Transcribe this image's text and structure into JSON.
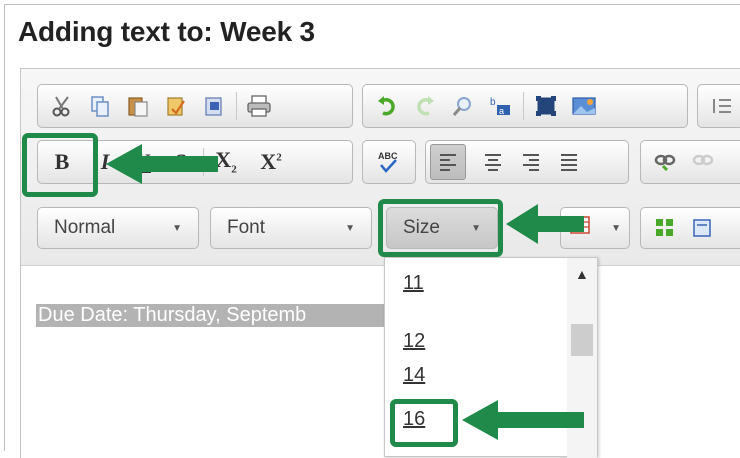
{
  "title": "Adding text to: Week 3",
  "toolbar": {
    "row2": {
      "bold": "B",
      "italic": "I",
      "underline": "U",
      "strike": "S",
      "subscript": "X",
      "subscript_mark": "2",
      "superscript": "X",
      "superscript_mark": "2",
      "spellcheck": "ABC"
    },
    "row3": {
      "format_label": "Normal",
      "font_label": "Font",
      "size_label": "Size"
    }
  },
  "content": {
    "selected_text": "Due Date: Thursday, Septemb"
  },
  "size_dropdown": {
    "options": [
      "11",
      "12",
      "14",
      "16"
    ],
    "highlighted": "16"
  },
  "colors": {
    "highlight": "#1f8a49",
    "selection": "#b3b3b3"
  },
  "icons": [
    "cut-icon",
    "copy-icon",
    "paste-icon",
    "paste-text-icon",
    "paste-word-icon",
    "print-icon",
    "undo-icon",
    "redo-icon",
    "find-icon",
    "replace-icon",
    "select-all-icon",
    "image-icon",
    "list-icon",
    "link-icon",
    "unlink-icon",
    "text-color-icon",
    "source-icon",
    "template-icon"
  ]
}
